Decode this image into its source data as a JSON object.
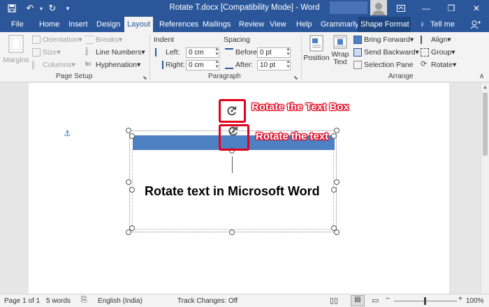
{
  "titlebar": {
    "title": "Rotate T.docx [Compatibility Mode] - Word"
  },
  "tabs": [
    "File",
    "Home",
    "Insert",
    "Design",
    "Layout",
    "References",
    "Mailings",
    "Review",
    "View",
    "Help",
    "Grammarly",
    "Shape Format",
    "Tell me"
  ],
  "ribbon": {
    "page_setup": {
      "margins": "Margins",
      "orientation": "Orientation",
      "size": "Size",
      "columns": "Columns",
      "breaks": "Breaks",
      "line_numbers": "Line Numbers",
      "hyphenation": "Hyphenation",
      "label": "Page Setup"
    },
    "paragraph": {
      "indent_label": "Indent",
      "spacing_label": "Spacing",
      "left_label": "Left:",
      "right_label": "Right:",
      "before_label": "Before:",
      "after_label": "After:",
      "left_value": "0 cm",
      "right_value": "0 cm",
      "before_value": "0 pt",
      "after_value": "10 pt",
      "label": "Paragraph"
    },
    "arrange": {
      "position": "Position",
      "wrap_text_1": "Wrap",
      "wrap_text_2": "Text",
      "bring_forward": "Bring Forward",
      "send_backward": "Send Backward",
      "selection_pane": "Selection Pane",
      "align": "Align",
      "group": "Group",
      "rotate": "Rotate",
      "label": "Arrange"
    }
  },
  "document": {
    "body_text": "Rotate text in Microsoft Word",
    "callout_textbox": "Rotate the Text Box",
    "callout_text": "Rotate the text"
  },
  "status": {
    "page": "Page 1 of 1",
    "words": "5 words",
    "language": "English (India)",
    "track_changes": "Track Changes: Off",
    "zoom": "100%"
  },
  "colors": {
    "brand": "#2b579a",
    "callout": "#e3001b",
    "shape_fill": "#4e81c4"
  }
}
